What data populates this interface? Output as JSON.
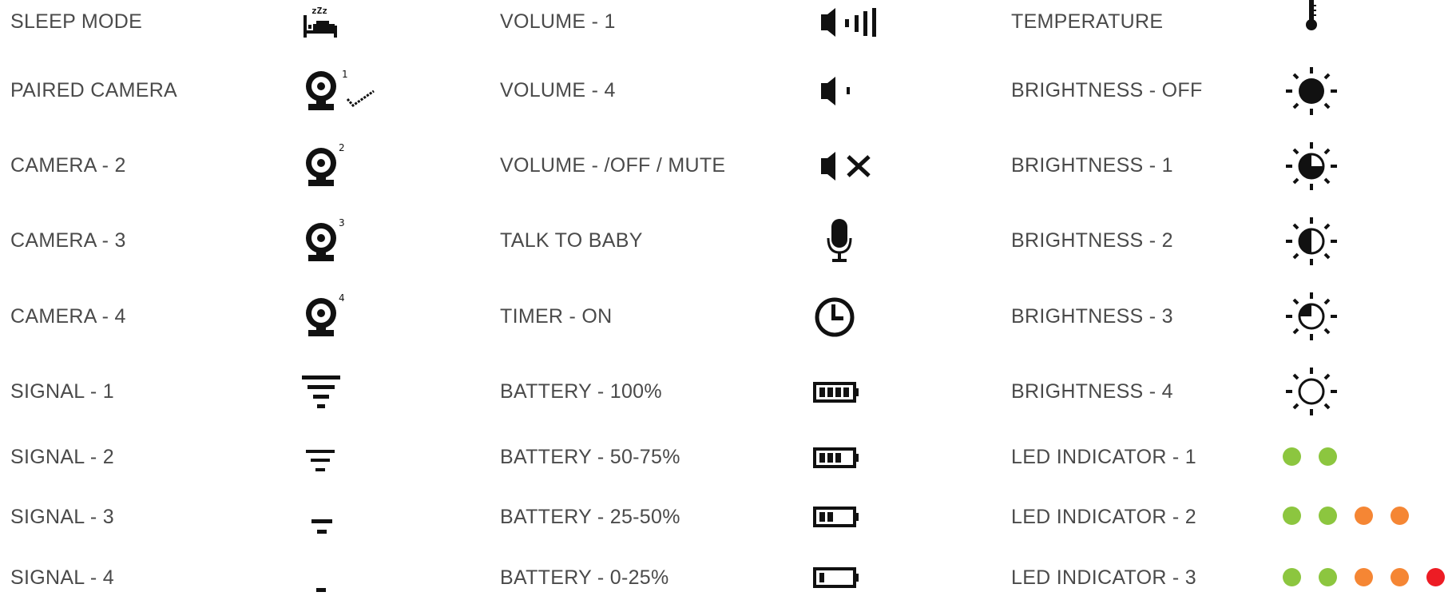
{
  "colors": {
    "text": "#4a4a4a",
    "icon": "#111111",
    "led_green": "#8cc63f",
    "led_orange": "#f58634",
    "led_red": "#ed1c24"
  },
  "col1": [
    {
      "label": "SLEEP MODE",
      "icon": "sleep-mode-icon"
    },
    {
      "label": "PAIRED CAMERA",
      "icon": "paired-camera-icon"
    },
    {
      "label": "CAMERA - 2",
      "icon": "camera-2-icon"
    },
    {
      "label": "CAMERA - 3",
      "icon": "camera-3-icon"
    },
    {
      "label": "CAMERA - 4",
      "icon": "camera-4-icon"
    },
    {
      "label": "SIGNAL - 1",
      "icon": "signal-1-icon"
    },
    {
      "label": "SIGNAL - 2",
      "icon": "signal-2-icon"
    },
    {
      "label": "SIGNAL - 3",
      "icon": "signal-3-icon"
    },
    {
      "label": "SIGNAL - 4",
      "icon": "signal-4-icon"
    }
  ],
  "col2": [
    {
      "label": "VOLUME - 1",
      "icon": "volume-1-icon"
    },
    {
      "label": "VOLUME - 4",
      "icon": "volume-4-icon"
    },
    {
      "label": "VOLUME - /OFF / MUTE",
      "icon": "volume-mute-icon"
    },
    {
      "label": "TALK TO BABY",
      "icon": "microphone-icon"
    },
    {
      "label": "TIMER - ON",
      "icon": "timer-icon"
    },
    {
      "label": "BATTERY - 100%",
      "icon": "battery-100-icon"
    },
    {
      "label": "BATTERY - 50-75%",
      "icon": "battery-50-75-icon"
    },
    {
      "label": "BATTERY - 25-50%",
      "icon": "battery-25-50-icon"
    },
    {
      "label": "BATTERY - 0-25%",
      "icon": "battery-0-25-icon"
    }
  ],
  "col3": [
    {
      "label": "TEMPERATURE",
      "icon": "thermometer-icon"
    },
    {
      "label": "BRIGHTNESS - OFF",
      "icon": "brightness-off-icon"
    },
    {
      "label": "BRIGHTNESS - 1",
      "icon": "brightness-1-icon"
    },
    {
      "label": "BRIGHTNESS - 2",
      "icon": "brightness-2-icon"
    },
    {
      "label": "BRIGHTNESS - 3",
      "icon": "brightness-3-icon"
    },
    {
      "label": "BRIGHTNESS - 4",
      "icon": "brightness-4-icon"
    },
    {
      "label": "LED INDICATOR - 1",
      "icon": "led-indicator-1-icon",
      "leds": [
        "green",
        "green"
      ]
    },
    {
      "label": "LED INDICATOR - 2",
      "icon": "led-indicator-2-icon",
      "leds": [
        "green",
        "green",
        "orange",
        "orange"
      ]
    },
    {
      "label": "LED INDICATOR - 3",
      "icon": "led-indicator-3-icon",
      "leds": [
        "green",
        "green",
        "orange",
        "orange",
        "red"
      ]
    }
  ],
  "camera_numbers": {
    "paired": "1",
    "cam2": "2",
    "cam3": "3",
    "cam4": "4"
  },
  "sleep_zzz": "zZz"
}
